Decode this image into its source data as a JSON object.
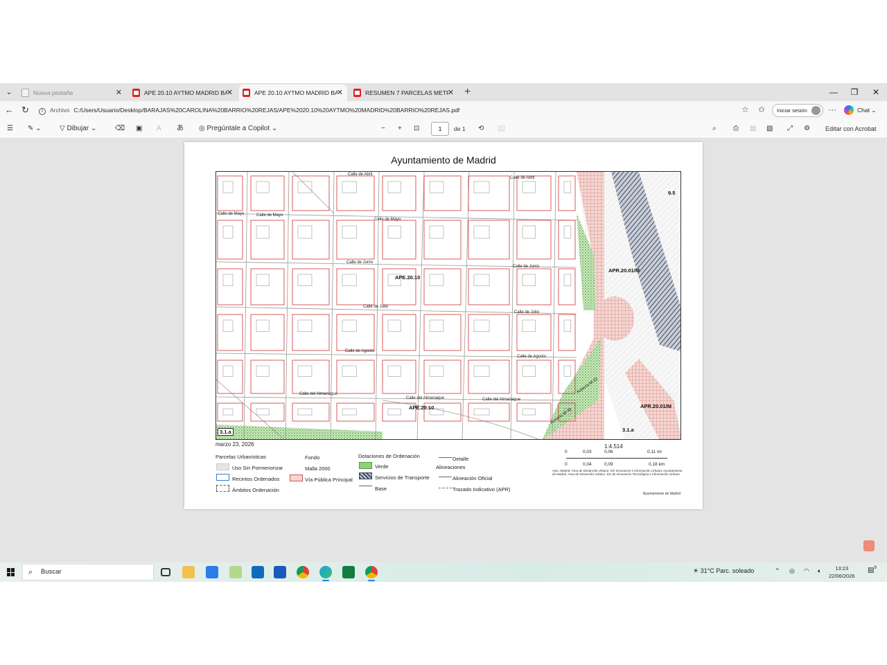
{
  "browser": {
    "tabs": [
      {
        "label": "Nueva pestaña",
        "state": "inactive",
        "icon": "blank-page-icon"
      },
      {
        "label": "APE 20.10 AYTMO MADRID BARRI",
        "state": "normal",
        "icon": "pdf-icon"
      },
      {
        "label": "APE 20.10 AYTMO MADRID BARRI",
        "state": "active",
        "icon": "pdf-icon"
      },
      {
        "label": "RESUMEN 7 PARCELAS METROS Y",
        "state": "normal",
        "icon": "pdf-icon"
      }
    ],
    "new_tab": "+",
    "window_controls": {
      "minimize": "—",
      "restore": "❐",
      "close": "✕"
    },
    "address": {
      "scheme_label": "Archivo",
      "url": "C:/Users/Usuario/Desktop/BARAJAS%20CAROLINA%20BARRIO%20REJAS/APE%2020.10%20AYTMO%20MADRID%20BARRIO%20REJAS.pdf"
    },
    "signin_label": "Iniciar sesión",
    "chat_label": "Chat"
  },
  "pdf_toolbar": {
    "draw_label": "Dibujar",
    "copilot_label": "Pregúntale a Copilot",
    "zoom_out": "−",
    "zoom_in": "+",
    "page_current": "1",
    "page_total": "de 1",
    "edit_acrobat_label": "Editar con Acrobat"
  },
  "document": {
    "title": "Ayuntamiento de Madrid",
    "date": "marzo 23, 2026",
    "map_labels": {
      "streets": [
        "Calle de Abril",
        "Calle de Mayo",
        "Calle de Mayo",
        "Calle de Mayo",
        "Calle de Junio",
        "Calle de Junio",
        "Calle de Julio",
        "Calle de Julio",
        "Calle de Agosto",
        "Calle de Agosto",
        "Calle del Almanaque",
        "Calle del Almanaque",
        "Calle del Almanaque",
        "Calle de Abril",
        "Autovía M-40",
        "Autovía M-22"
      ],
      "zones": [
        "APE.20.10",
        "APE.20.10",
        "APR.20.01/M",
        "APR.20.01/M",
        "9.5",
        "3.1.a",
        "3.1.a"
      ]
    },
    "legend": {
      "parcelas_title": "Parcelas Urbanísticas",
      "parcelas": [
        "Uso Sin Pormenorizar",
        "Recintos Ordenados",
        "Ámbitos Ordenación"
      ],
      "fondo_title": "Fondo",
      "fondo": [
        "Malla 2000",
        "Vía Pública Principal"
      ],
      "dotaciones_title": "Dotaciones de Ordenación",
      "dotaciones": [
        "Verde",
        "Servicios de Transporte",
        "Base"
      ],
      "detalle": "Detalle",
      "alineaciones_title": "Alineaciones",
      "alineaciones": [
        "Alineación Oficial",
        "Trazado Indicativo (APR)"
      ]
    },
    "scale": {
      "ratio": "1:4.514",
      "mi_ticks": [
        "0",
        "0,03",
        "0,06",
        "0,11 mi"
      ],
      "km_ticks": [
        "0",
        "0,04",
        "0,09",
        "0,18 km"
      ]
    },
    "credit": "Ayto. Madrid. Área de Desarrollo Urbano. SG Innovación e Información Urbana; Ayuntamiento de Madrid. Área de Desarrollo Urbano. SG de Innovación Tecnológica e Información Urbana",
    "footer": "Ayuntamiento de Madrid"
  },
  "taskbar": {
    "search_label": "Buscar",
    "weather": "31°C  Parc. soleado",
    "time": "13:23",
    "date": "22/06/2026",
    "notif_count": "9"
  },
  "colors": {
    "parcel_line": "#cc3333",
    "green_zone": "#5db34a",
    "transport_hatch": "#4a5670",
    "apr_zone": "#e8b7b0"
  }
}
